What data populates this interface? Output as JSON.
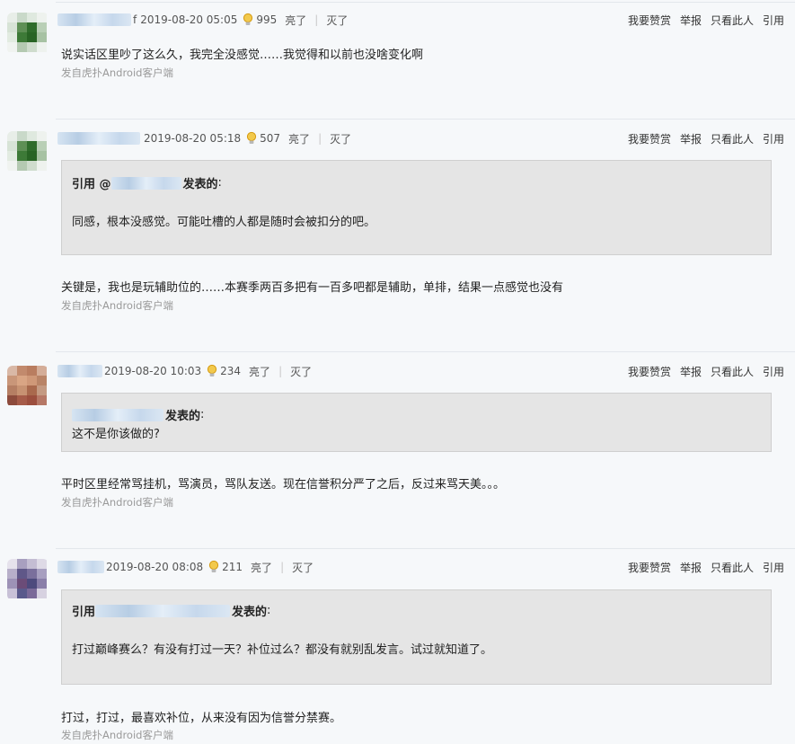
{
  "actions": {
    "reward": "我要赞赏",
    "report": "举报",
    "only_this": "只看此人",
    "quote": "引用"
  },
  "vote": {
    "up": "亮了",
    "down": "灭了",
    "sep": "|"
  },
  "colors": {
    "bulb": "#e3a51a",
    "quote_bg": "#e5e5e5",
    "page_bg": "#f6f8fa",
    "source": "#9a9a9a"
  },
  "icons": {
    "light": "lightbulb-icon"
  },
  "posts": [
    {
      "author_suffix": "f",
      "time": "2019-08-20 05:05",
      "lights": "995",
      "content": "说实话区里吵了这么久，我完全没感觉……我觉得和以前也没啥变化啊",
      "source": "发自虎扑Android客户端"
    },
    {
      "time": "2019-08-20 05:18",
      "lights": "507",
      "quote_prefix": "引用 @",
      "quote_suffix": "发表的",
      "quote_colon": ":",
      "quote_text": "同感，根本没感觉。可能吐槽的人都是随时会被扣分的吧。",
      "content": "关键是，我也是玩辅助位的……本赛季两百多把有一百多吧都是辅助，单排，结果一点感觉也没有",
      "source": "发自虎扑Android客户端"
    },
    {
      "time": "2019-08-20 10:03",
      "lights": "234",
      "quote_suffix": "发表的",
      "quote_colon": ":",
      "quote_text": "这不是你该做的?",
      "content": "平时区里经常骂挂机，骂演员，骂队友送。现在信誉积分严了之后，反过来骂天美。。。",
      "source": "发自虎扑Android客户端"
    },
    {
      "time": "2019-08-20 08:08",
      "lights": "211",
      "quote_prefix": "引用",
      "quote_suffix": "发表的",
      "quote_colon": ":",
      "quote_text": "打过巅峰赛么？有没有打过一天？补位过么？都没有就别乱发言。试过就知道了。",
      "content": "打过，打过，最喜欢补位，从来没有因为信誉分禁赛。",
      "source": "发自虎扑Android客户端"
    }
  ]
}
